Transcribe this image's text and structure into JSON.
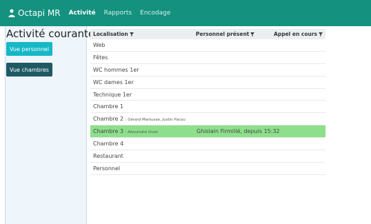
{
  "app": {
    "brand": "Octapi MR"
  },
  "nav": [
    {
      "label": "Activité",
      "active": true
    },
    {
      "label": "Rapports",
      "active": false
    },
    {
      "label": "Encodage",
      "active": false
    }
  ],
  "sidebar": {
    "title": "Activité courante",
    "buttons": {
      "persons": "Vue personnel",
      "rooms": "Vue chambres"
    }
  },
  "table": {
    "headers": {
      "location": "Localisation",
      "staff": "Personnel présent",
      "call": "Appel en cours"
    },
    "rows": [
      {
        "location": "Web",
        "extra": "",
        "staff": "",
        "call": ""
      },
      {
        "location": "Fêtes",
        "extra": "",
        "staff": "",
        "call": ""
      },
      {
        "location": "WC hommes 1er",
        "extra": "",
        "staff": "",
        "call": ""
      },
      {
        "location": "WC dames 1er",
        "extra": "",
        "staff": "",
        "call": ""
      },
      {
        "location": "Technique 1er",
        "extra": "",
        "staff": "",
        "call": ""
      },
      {
        "location": "Chambre 1",
        "extra": "",
        "staff": "",
        "call": ""
      },
      {
        "location": "Chambre 2",
        "extra": ": Gérard Marsusse, Justin Pacou",
        "staff": "",
        "call": ""
      },
      {
        "location": "Chambre 3",
        "extra": ": Alexandre Ouzo",
        "staff": "Ghislain Firmillé, depuis 15:32",
        "call": "",
        "highlight": true
      },
      {
        "location": "Chambre 4",
        "extra": "",
        "staff": "",
        "call": ""
      },
      {
        "location": "Restaurant",
        "extra": "",
        "staff": "",
        "call": ""
      },
      {
        "location": "Personnel",
        "extra": "",
        "staff": "",
        "call": ""
      }
    ]
  },
  "colors": {
    "navbar": "#14917f",
    "sidebar": "#eef5fb",
    "btn_persons": "#16b8c6",
    "btn_rooms": "#1f5a63",
    "highlight": "#8de08b"
  }
}
